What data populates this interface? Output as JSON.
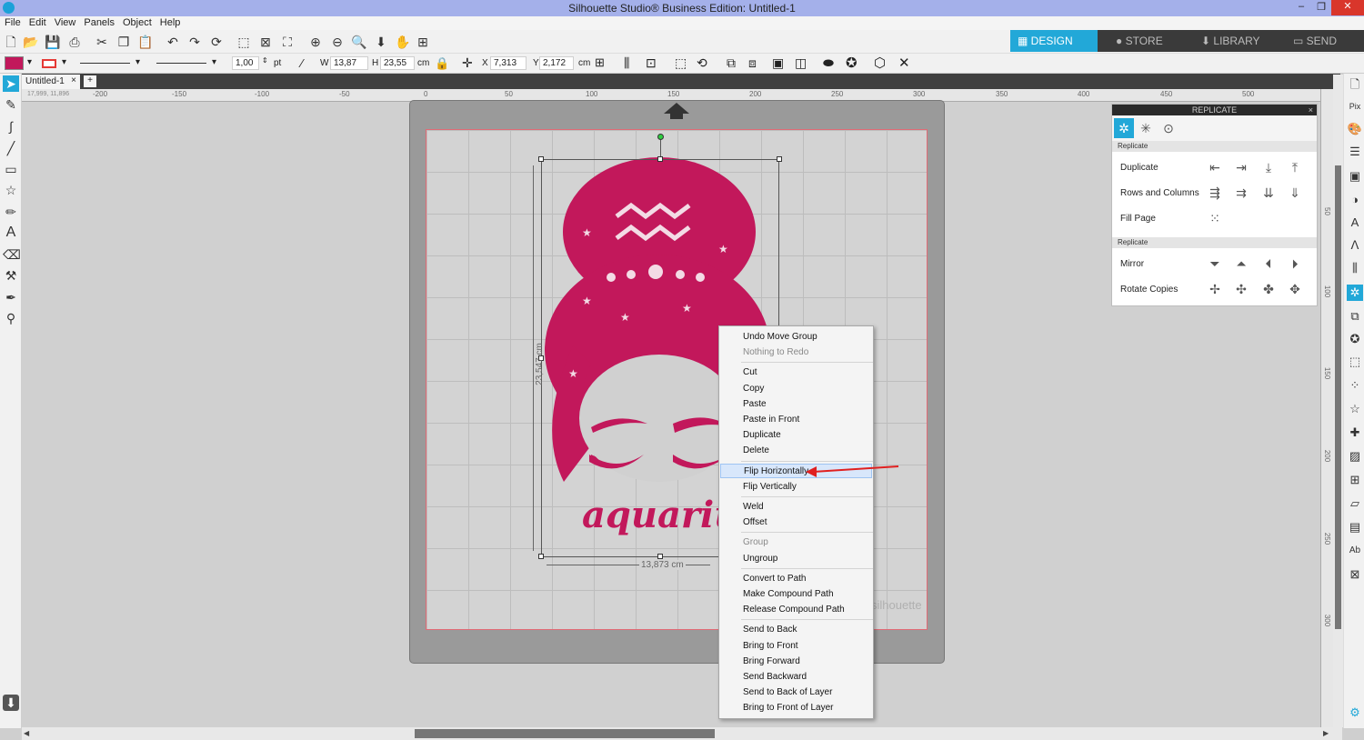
{
  "window": {
    "title": "Silhouette Studio® Business Edition: Untitled-1",
    "minimize": "–",
    "maximize": "❐",
    "close": "✕"
  },
  "menu": [
    "File",
    "Edit",
    "View",
    "Panels",
    "Object",
    "Help"
  ],
  "nav_tabs": [
    "DESIGN",
    "STORE",
    "LIBRARY",
    "SEND"
  ],
  "active_nav_tab": "DESIGN",
  "props": {
    "line_width_value": "1,00",
    "line_width_unit": "pt",
    "w_label": "W",
    "w_value": "13,87",
    "h_label": "H",
    "h_value": "23,55",
    "size_unit": "cm",
    "x_label": "X",
    "x_value": "7,313",
    "y_label": "Y",
    "y_value": "2,172",
    "pos_unit": "cm"
  },
  "document": {
    "tab_name": "Untitled-1",
    "close_tab": "×",
    "add_tab": "+"
  },
  "ruler": {
    "labels": [
      "-200",
      "-150",
      "-100",
      "-50",
      "0",
      "50",
      "100",
      "150",
      "200",
      "250",
      "300",
      "350",
      "400",
      "450",
      "500"
    ],
    "coord_readout": "17,999, 11,896",
    "v_labels": [
      "50",
      "100",
      "150",
      "200",
      "250",
      "300"
    ]
  },
  "design": {
    "text": "aquarius",
    "height_dim": "23,547 cm",
    "width_dim": "13,873 cm",
    "watermark": "silhouette",
    "fill_color": "#c2185b"
  },
  "context_menu": [
    {
      "label": "Undo Move Group",
      "enabled": true
    },
    {
      "label": "Nothing to Redo",
      "enabled": false
    },
    {
      "sep": true
    },
    {
      "label": "Cut",
      "enabled": true
    },
    {
      "label": "Copy",
      "enabled": true
    },
    {
      "label": "Paste",
      "enabled": true
    },
    {
      "label": "Paste in Front",
      "enabled": true
    },
    {
      "label": "Duplicate",
      "enabled": true
    },
    {
      "label": "Delete",
      "enabled": true
    },
    {
      "sep": true
    },
    {
      "label": "Flip Horizontally",
      "enabled": true,
      "highlighted": true
    },
    {
      "label": "Flip Vertically",
      "enabled": true
    },
    {
      "sep": true
    },
    {
      "label": "Weld",
      "enabled": true
    },
    {
      "label": "Offset",
      "enabled": true
    },
    {
      "sep": true
    },
    {
      "label": "Group",
      "enabled": false
    },
    {
      "label": "Ungroup",
      "enabled": true
    },
    {
      "sep": true
    },
    {
      "label": "Convert to Path",
      "enabled": true
    },
    {
      "label": "Make Compound Path",
      "enabled": true
    },
    {
      "label": "Release Compound Path",
      "enabled": true
    },
    {
      "sep": true
    },
    {
      "label": "Send to Back",
      "enabled": true
    },
    {
      "label": "Bring to Front",
      "enabled": true
    },
    {
      "label": "Bring Forward",
      "enabled": true
    },
    {
      "label": "Send Backward",
      "enabled": true
    },
    {
      "label": "Send to Back of Layer",
      "enabled": true
    },
    {
      "label": "Bring to Front of Layer",
      "enabled": true
    }
  ],
  "replicate_panel": {
    "title": "REPLICATE",
    "close": "×",
    "section1": "Replicate",
    "section2": "Replicate",
    "rows": {
      "duplicate": "Duplicate",
      "rows_columns": "Rows and Columns",
      "fill_page": "Fill Page",
      "mirror": "Mirror",
      "rotate_copies": "Rotate Copies"
    }
  },
  "colors": {
    "accent": "#22a8d8",
    "design_pink": "#c2185b",
    "annotation_red": "#e02020",
    "fill_swatch": "#c2185b",
    "stroke_swatch": "#e53935"
  }
}
